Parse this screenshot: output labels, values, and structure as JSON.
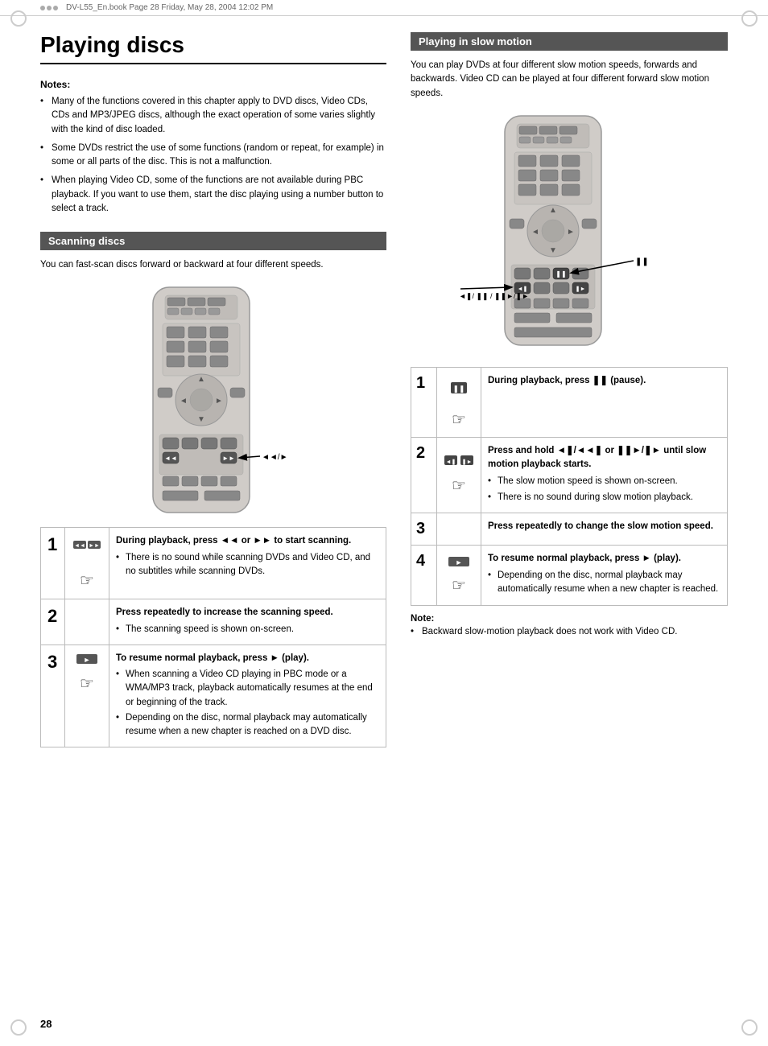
{
  "page": {
    "number": "28",
    "header_text": "DV-L55_En.book  Page 28  Friday, May 28, 2004  12:02 PM"
  },
  "title": "Playing discs",
  "left_col": {
    "notes_label": "Notes:",
    "notes": [
      "Many of the functions covered in this chapter apply to DVD discs, Video CDs, CDs and MP3/JPEG discs, although the exact operation of some varies slightly with the kind of disc loaded.",
      "Some DVDs restrict the use of some functions (random or repeat, for example) in some or all parts of the disc. This is not a malfunction.",
      "When playing Video CD, some of the functions are not available during PBC playback. If you want to use them, start the disc playing using a number button to select a track."
    ],
    "scanning_section": {
      "header": "Scanning discs",
      "description": "You can fast-scan discs forward or backward at four different speeds.",
      "steps": [
        {
          "num": "1",
          "instruction": "During playback, press ◄◄ or ►► to start scanning.",
          "bullets": [
            "There is no sound while scanning DVDs and Video CD, and no subtitles while scanning DVDs."
          ]
        },
        {
          "num": "2",
          "instruction": "Press repeatedly to increase the scanning speed.",
          "bullets": [
            "The scanning speed is shown on-screen."
          ]
        },
        {
          "num": "3",
          "instruction": "To resume normal playback, press ► (play).",
          "bullets": [
            "When scanning a Video CD playing in PBC mode or a WMA/MP3 track, playback automatically resumes at the end or beginning of the track.",
            "Depending on the disc, normal playback may automatically resume when a new chapter is reached on a DVD disc."
          ]
        }
      ]
    }
  },
  "right_col": {
    "slow_motion_section": {
      "header": "Playing in slow motion",
      "description": "You can play DVDs at four different slow motion speeds, forwards and backwards. Video CD can be played at four different forward slow motion speeds.",
      "steps": [
        {
          "num": "1",
          "instruction": "During playback, press ❚❚ (pause).",
          "bullets": []
        },
        {
          "num": "2",
          "instruction": "Press and hold ◄❚/◄◄❚ or ❚❚►/❚► until slow motion playback starts.",
          "bullets": [
            "The slow motion speed is shown on-screen.",
            "There is no sound during slow motion playback."
          ]
        },
        {
          "num": "3",
          "instruction": "Press repeatedly to change the slow motion speed.",
          "bullets": []
        },
        {
          "num": "4",
          "instruction": "To resume normal playback, press ► (play).",
          "bullets": [
            "Depending on the disc, normal playback may automatically resume when a new chapter is reached."
          ]
        }
      ]
    },
    "note": {
      "label": "Note:",
      "bullets": [
        "Backward slow-motion playback does not work with Video CD."
      ]
    }
  },
  "remote_labels": {
    "scanning": "◄◄/►",
    "slow_motion_top": "◄❚/ ❚❚ / ❚❚►/❚►",
    "slow_motion_pause": "❚❚",
    "slow_motion_arrows": "◄❚/ ❚❚ / ❚❚►/❚►"
  }
}
